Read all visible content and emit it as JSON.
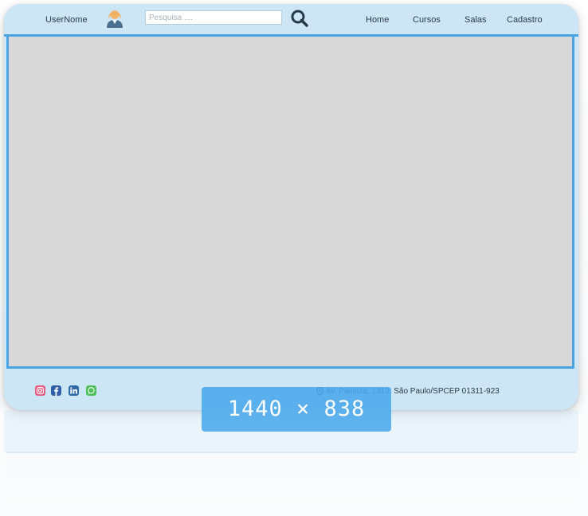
{
  "header": {
    "user_name": "UserNome",
    "search_placeholder": "Pesquisa ....",
    "nav": [
      "Home",
      "Cursos",
      "Salas",
      "Cadastro"
    ]
  },
  "footer": {
    "address": "Av. Paulista, 1313, São Paulo/SPCEP 01311-923",
    "social": [
      "instagram-icon",
      "facebook-icon",
      "linkedin-icon",
      "whatsapp-icon"
    ]
  },
  "overlay": {
    "dimensions": "1440 × 838"
  },
  "colors": {
    "bar_bg": "#cde6f6",
    "accent_border": "#4ba3e0",
    "content_bg": "#d8d8d8",
    "overlay_bg": "#4aa8ec"
  }
}
